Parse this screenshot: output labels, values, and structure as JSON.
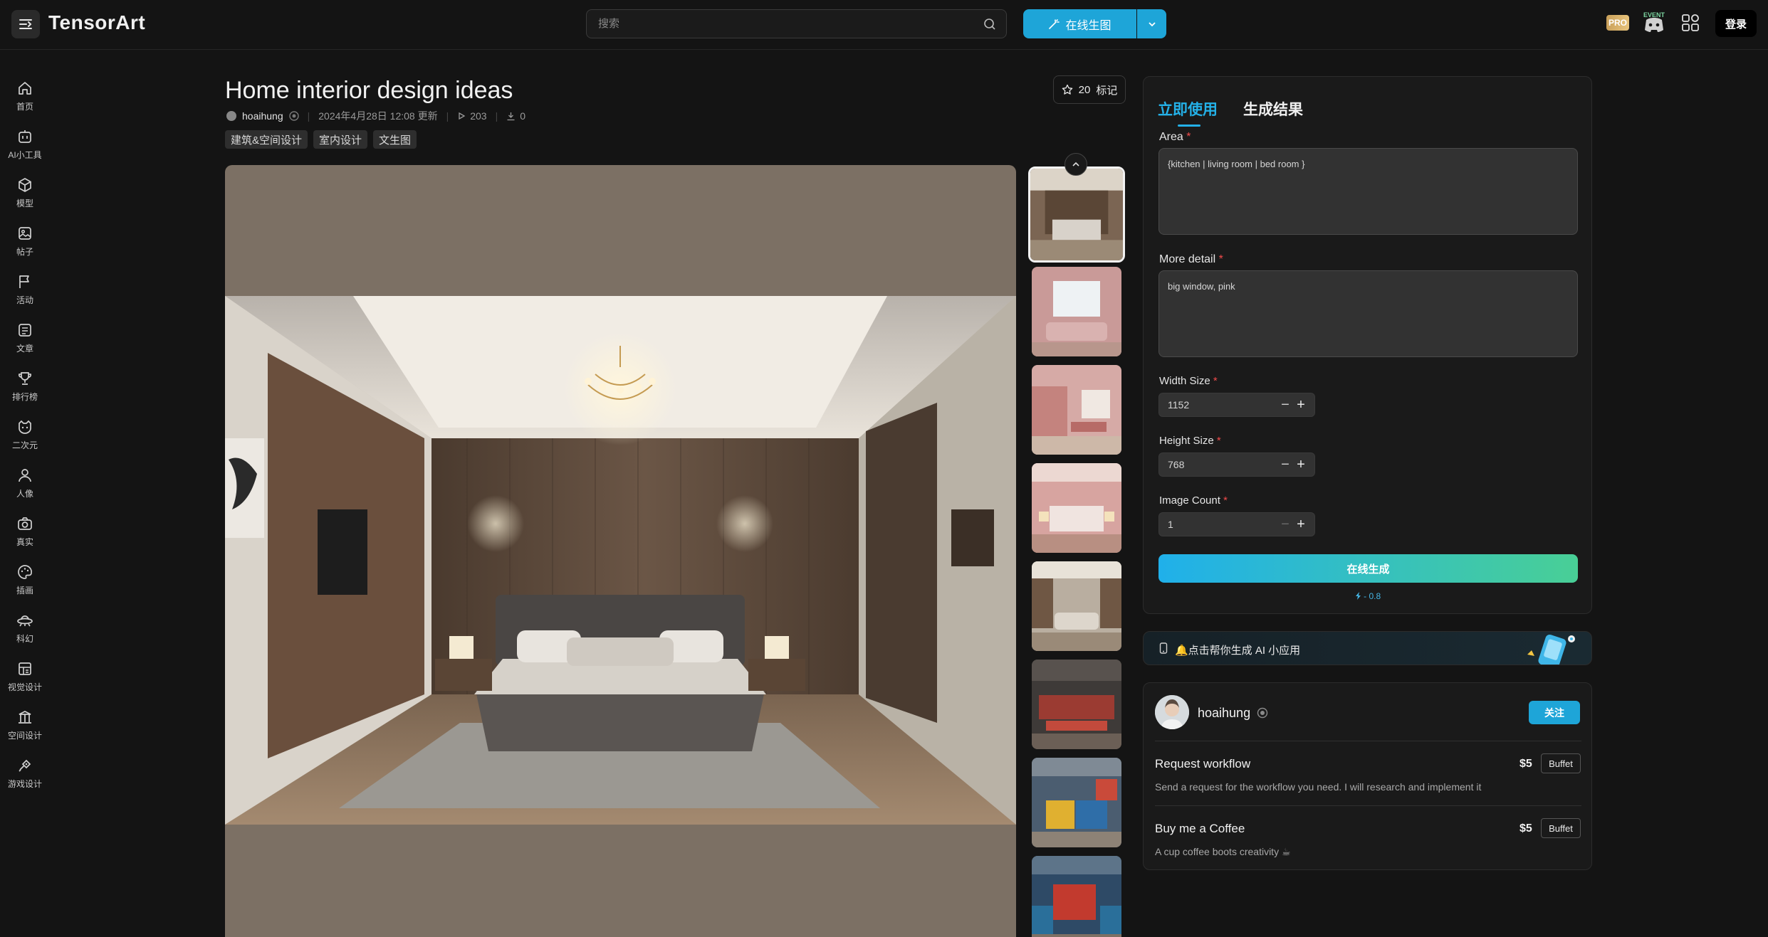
{
  "header": {
    "logo": "TensorArt",
    "search_placeholder": "搜索",
    "generate_label": "在线生图",
    "pro_badge": "PRO",
    "event_label": "EVENT",
    "login_label": "登录"
  },
  "sidebar": {
    "items": [
      {
        "label": "首页",
        "icon": "home-icon"
      },
      {
        "label": "AI小工具",
        "icon": "ai-tools-icon"
      },
      {
        "label": "模型",
        "icon": "model-cube-icon"
      },
      {
        "label": "帖子",
        "icon": "post-image-icon"
      },
      {
        "label": "活动",
        "icon": "flag-icon"
      },
      {
        "label": "文章",
        "icon": "article-icon"
      },
      {
        "label": "排行榜",
        "icon": "trophy-icon"
      },
      {
        "label": "二次元",
        "icon": "anime-face-icon"
      },
      {
        "label": "人像",
        "icon": "person-icon"
      },
      {
        "label": "真实",
        "icon": "camera-icon"
      },
      {
        "label": "插画",
        "icon": "palette-icon"
      },
      {
        "label": "科幻",
        "icon": "ufo-icon"
      },
      {
        "label": "视觉设计",
        "icon": "visual-design-icon"
      },
      {
        "label": "空间设计",
        "icon": "space-design-icon"
      },
      {
        "label": "游戏设计",
        "icon": "game-design-icon"
      }
    ]
  },
  "post": {
    "title": "Home interior design ideas",
    "author": "hoaihung",
    "updated": "2024年4月28日 12:08 更新",
    "runs": "203",
    "downloads": "0",
    "tags": [
      "建筑&空间设计",
      "室内设计",
      "文生图"
    ],
    "mark_count": "20",
    "mark_label": "标记"
  },
  "thumbnails": [
    "bedroom-wood",
    "living-pink-window",
    "kitchen-pink",
    "bedroom-pink",
    "living-room-gray",
    "kitchen-red",
    "kitchen-yellow-blue",
    "kitchen-blue-red"
  ],
  "panel": {
    "tabs": [
      "立即使用",
      "生成结果"
    ],
    "fields": {
      "area_label": "Area",
      "area_value": "{kitchen | living room | bed room }",
      "detail_label": "More detail",
      "detail_value": "big window, pink",
      "width_label": "Width Size",
      "width_value": "1152",
      "height_label": "Height Size",
      "height_value": "768",
      "count_label": "Image Count",
      "count_value": "1"
    },
    "required_mark": "*",
    "generate_label": "在线生成",
    "cost": "- 0.8"
  },
  "ai_banner": {
    "text": "🔔点击帮你生成 AI 小应用"
  },
  "author_card": {
    "name": "hoaihung",
    "follow_label": "关注",
    "services": [
      {
        "title": "Request workflow",
        "price": "$5",
        "badge": "Buffet",
        "desc": "Send a request for the workflow you need. I will research and implement it"
      },
      {
        "title": "Buy me a Coffee",
        "price": "$5",
        "badge": "Buffet",
        "desc": "A cup coffee boots creativity ☕"
      }
    ]
  },
  "colors": {
    "accent": "#1ea5d8",
    "gradient_end": "#49cf96",
    "required": "#f04b4b"
  }
}
